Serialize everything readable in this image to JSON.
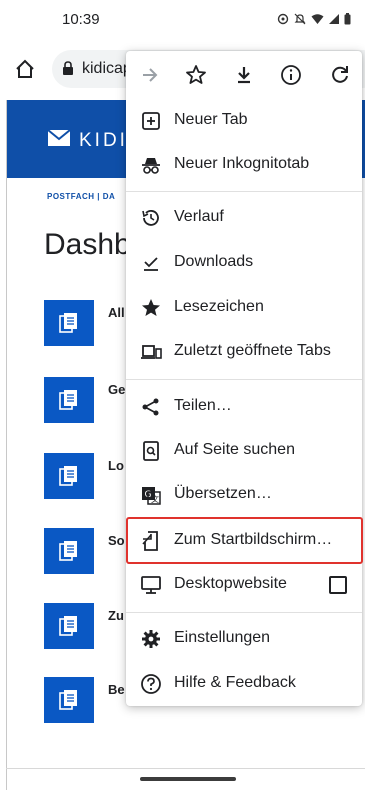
{
  "status_bar": {
    "time": "10:39"
  },
  "browser": {
    "url": "kidicap",
    "top_actions": [
      "forward-icon",
      "bookmark-star-icon",
      "download-icon",
      "info-icon",
      "reload-icon"
    ]
  },
  "page": {
    "brand": "KIDI",
    "breadcrumb": "POSTFACH | DA",
    "title": "Dashb",
    "items": [
      {
        "label": "All"
      },
      {
        "label": "Ge"
      },
      {
        "label": "Lo"
      },
      {
        "label": "So"
      },
      {
        "label": "Zu"
      },
      {
        "label": "Be"
      }
    ]
  },
  "menu": {
    "items": [
      {
        "label": "Neuer Tab",
        "icon": "new-tab-icon"
      },
      {
        "label": "Neuer Inkognitotab",
        "icon": "incognito-icon"
      },
      {
        "label": "Verlauf",
        "icon": "history-icon"
      },
      {
        "label": "Downloads",
        "icon": "downloads-icon"
      },
      {
        "label": "Lesezeichen",
        "icon": "bookmarks-icon"
      },
      {
        "label": "Zuletzt geöffnete Tabs",
        "icon": "recent-tabs-icon"
      },
      {
        "label": "Teilen…",
        "icon": "share-icon"
      },
      {
        "label": "Auf Seite suchen",
        "icon": "find-in-page-icon"
      },
      {
        "label": "Übersetzen…",
        "icon": "translate-icon"
      },
      {
        "label": "Zum Startbildschirm…",
        "icon": "add-to-home-icon"
      },
      {
        "label": "Desktopwebsite",
        "icon": "desktop-icon",
        "checked": false
      },
      {
        "label": "Einstellungen",
        "icon": "settings-icon"
      },
      {
        "label": "Hilfe & Feedback",
        "icon": "help-icon"
      }
    ]
  },
  "colors": {
    "brand_blue": "#0f4fa8",
    "tile_blue": "#0a58c4",
    "highlight_red": "#e0322d"
  }
}
